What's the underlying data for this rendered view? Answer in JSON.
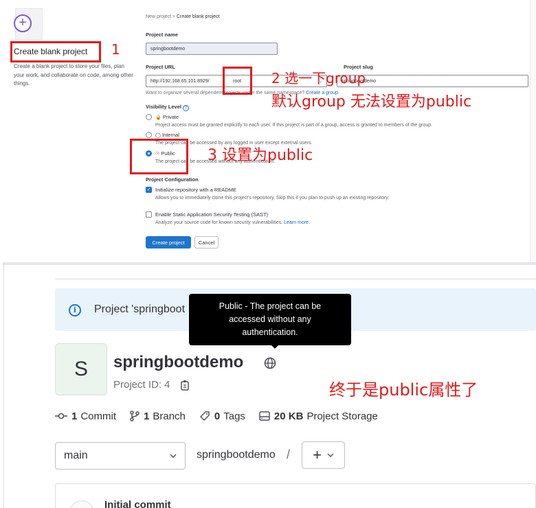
{
  "create_form": {
    "breadcrumb": [
      "New project",
      "Create blank project"
    ],
    "card": {
      "title": "Create blank project",
      "description": "Create a blank project to store your files, plan your work, and collaborate on code, among other things."
    },
    "project_name_label": "Project name",
    "project_name_value": "springbootdemo",
    "project_url_label": "Project URL",
    "project_url_prefix": "http://192.168.65.101:8929/",
    "project_url_group": "root",
    "project_slug_label": "Project slug",
    "project_slug_sep": "/",
    "project_slug_value": "springbootdemo",
    "namespace_hint": "Want to organize several dependent projects under the same namespace?",
    "namespace_hint_link": "Create a group.",
    "visibility_label": "Visibility Level",
    "visibility_options": [
      {
        "label": "Private",
        "desc": "Project access must be granted explicitly to each user. If this project is part of a group, access is granted to members of the group.",
        "selected": false
      },
      {
        "label": "Internal",
        "desc": "The project can be accessed by any logged in user except external users.",
        "selected": false
      },
      {
        "label": "Public",
        "desc": "The project can be accessed without any authentication.",
        "selected": true
      }
    ],
    "config_label": "Project Configuration",
    "config_options": [
      {
        "label": "Initialize repository with a README",
        "desc": "Allows you to immediately clone this project's repository. Skip this if you plan to push up an existing repository.",
        "checked": true
      },
      {
        "label": "Enable Static Application Security Testing (SAST)",
        "desc": "Analyze your source code for known security vulnerabilities.",
        "link": "Learn more.",
        "checked": false
      }
    ],
    "create_button": "Create project",
    "cancel_button": "Cancel"
  },
  "annotations": {
    "step1": "1",
    "step2_line1": "2 选一下group",
    "step2_line2": "默认group 无法设置为public",
    "step3": "3 设置为public",
    "final": "终于是public属性了",
    "color": "#e11a1a"
  },
  "project_page": {
    "alert_text": "Project 'springboot",
    "tooltip": [
      "Public - The project can be",
      "accessed without any",
      "authentication."
    ],
    "avatar_letter": "S",
    "project_name": "springbootdemo",
    "project_id": "Project ID: 4",
    "stats": [
      {
        "icon": "commit-icon",
        "value": "1",
        "label": "Commit"
      },
      {
        "icon": "branch-icon",
        "value": "1",
        "label": "Branch"
      },
      {
        "icon": "tag-icon",
        "value": "0",
        "label": "Tags"
      },
      {
        "icon": "storage-icon",
        "value": "20 KB",
        "label": "Project Storage"
      }
    ],
    "branch": "main",
    "path": "springbootdemo",
    "path_sep": "/",
    "plus_button": "+",
    "last_commit_title": "Initial commit"
  },
  "colors": {
    "accent": "#1f75cb",
    "annotation": "#e11a1a",
    "tooltip_bg": "#000000",
    "alert_bg": "#e9f3fc"
  }
}
